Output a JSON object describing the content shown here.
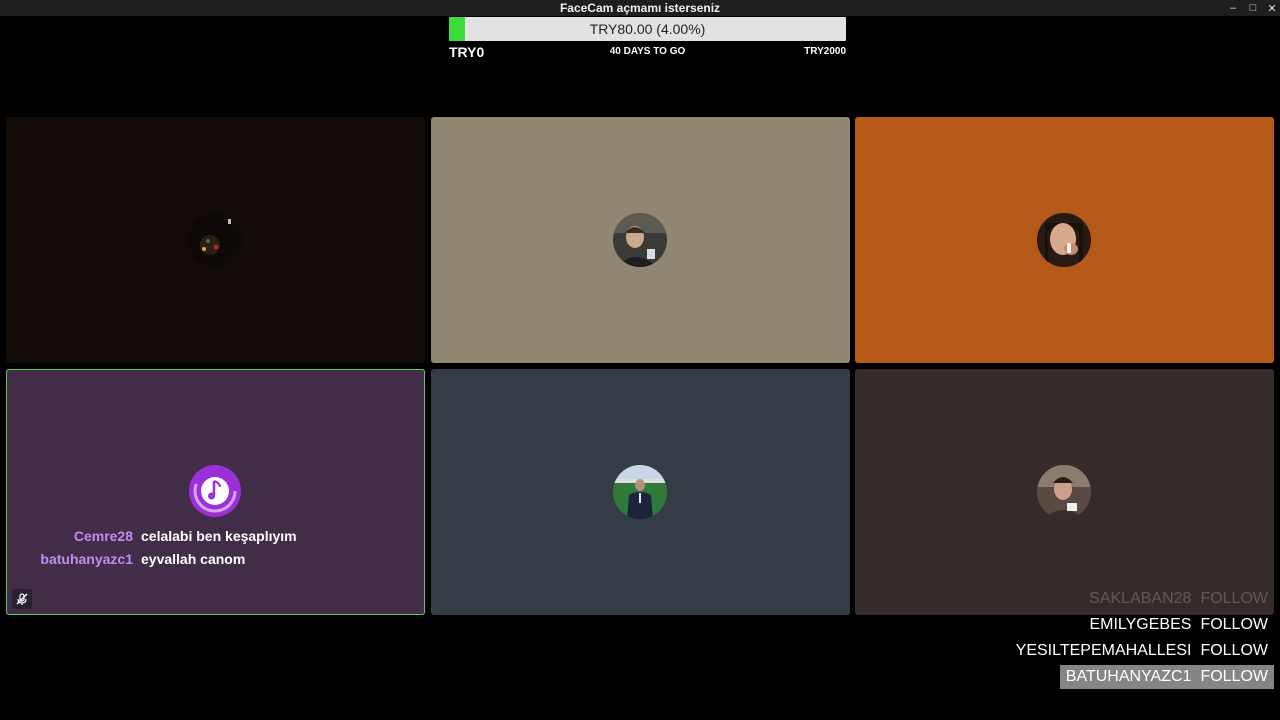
{
  "window": {
    "title": "FaceCam açmamı isterseniz",
    "controls": {
      "minimize": "–",
      "maximize": "□",
      "close": "✕"
    }
  },
  "goal": {
    "text": "TRY80.00 (4.00%)",
    "progress_percent": 4,
    "min_label": "TRY0",
    "days_label": "40 DAYS TO GO",
    "max_label": "TRY2000",
    "fill_color": "#3ddc3d"
  },
  "tiles": [
    {
      "bg": "#120b07",
      "avatar": "avatar-photo"
    },
    {
      "bg": "#918672",
      "avatar": "avatar-photo"
    },
    {
      "bg": "#b55a19",
      "avatar": "avatar-photo"
    },
    {
      "bg": "#412d47",
      "avatar": "music-disc-icon",
      "active": true,
      "border_color": "#59d35c"
    },
    {
      "bg": "#343c45",
      "avatar": "avatar-photo"
    },
    {
      "bg": "#352b2b",
      "avatar": "avatar-photo"
    }
  ],
  "chat": [
    {
      "user": "Cemre28",
      "message": "celalabi ben keşaplıyım"
    },
    {
      "user": "batuhanyazc1",
      "message": "eyvallah canom"
    }
  ],
  "chat_user_color": "#c48bf0",
  "mute_icon": "mic-muted-icon",
  "follow_list": [
    {
      "name": "SAKLABAN28",
      "action": "FOLLOW",
      "state": "faded"
    },
    {
      "name": "EMILYGEBES",
      "action": "FOLLOW",
      "state": "normal"
    },
    {
      "name": "YESILTEPEMAHALLESI",
      "action": "FOLLOW",
      "state": "normal"
    },
    {
      "name": "BATUHANYAZC1",
      "action": "FOLLOW",
      "state": "highlighted"
    }
  ]
}
